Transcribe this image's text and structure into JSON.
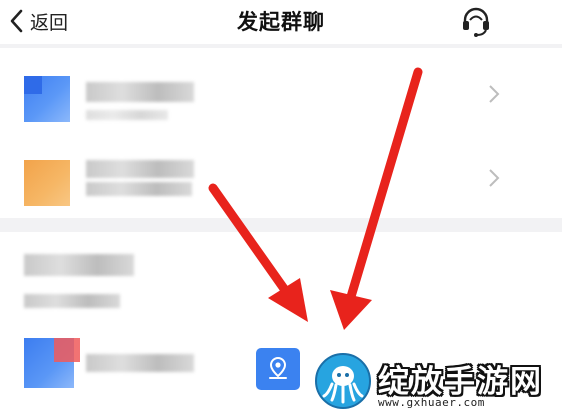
{
  "header": {
    "back_label": "返回",
    "title": "发起群聊",
    "support_icon": "headset-icon"
  },
  "options": [
    {
      "icon": "blue-square-icon",
      "label": "",
      "chevron_icon": "chevron-right-icon"
    },
    {
      "icon": "orange-square-icon",
      "label": "",
      "chevron_icon": "chevron-right-icon"
    }
  ],
  "section": {
    "title": "",
    "subtitle": ""
  },
  "contact": {
    "name": "",
    "action_icon": "location-pin-icon"
  },
  "watermark": {
    "title": "绽放手游网",
    "url": "www.gxhuaer.com"
  },
  "colors": {
    "accent": "#3b82f0",
    "arrow": "#e8231c",
    "background": "#f2f2f4"
  }
}
